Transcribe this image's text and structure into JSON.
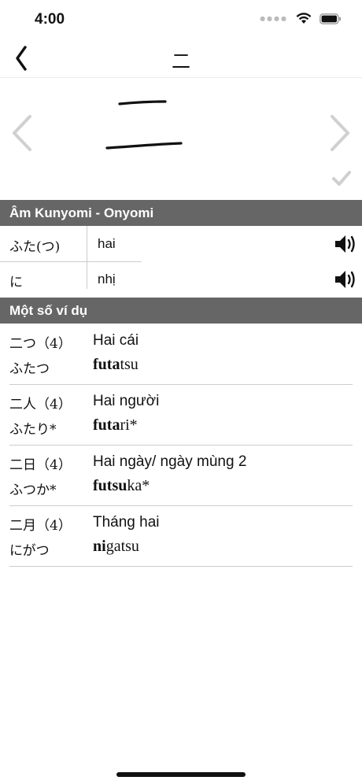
{
  "status_bar": {
    "time": "4:00",
    "icons": [
      "wifi-icon",
      "battery-icon"
    ]
  },
  "header": {
    "title": "二",
    "back_icon": "chevron-left-icon"
  },
  "kanji": {
    "prev_icon": "chevron-left-icon",
    "next_icon": "chevron-right-icon",
    "check_icon": "checkmark-icon"
  },
  "readings_section": {
    "title": "Âm Kunyomi - Onyomi",
    "rows": [
      {
        "kana": "ふた(つ)",
        "meaning": "hai"
      },
      {
        "kana": "に",
        "meaning": "nhị"
      }
    ]
  },
  "examples_section": {
    "title": "Một số ví dụ",
    "items": [
      {
        "word": "二つ（4）",
        "reading": "ふたつ",
        "meaning": "Hai cái",
        "romaji_bold": "futa",
        "romaji_rest": "tsu"
      },
      {
        "word": "二人（4）",
        "reading": "ふたり*",
        "meaning": "Hai người",
        "romaji_bold": "futa",
        "romaji_rest": "ri*"
      },
      {
        "word": "二日（4）",
        "reading": "ふつか*",
        "meaning": "Hai ngày/ ngày mùng 2",
        "romaji_bold": "futsu",
        "romaji_rest": "ka*"
      },
      {
        "word": "二月（4）",
        "reading": "にがつ",
        "meaning": "Tháng hai",
        "romaji_bold": "ni",
        "romaji_rest": "gatsu"
      }
    ]
  }
}
